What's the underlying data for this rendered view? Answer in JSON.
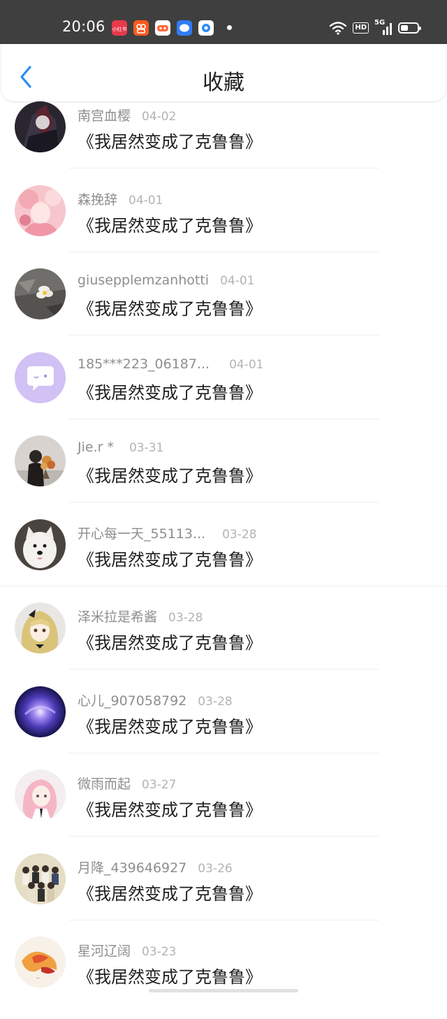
{
  "status_bar": {
    "time": "20:06",
    "hd_label": "HD",
    "network_label": "5G",
    "app_icons": [
      {
        "name": "xiaohongshu-app-icon",
        "color": "#e8394a"
      },
      {
        "name": "kuaishou-app-icon",
        "color": "#ff5a1f"
      },
      {
        "name": "game-center-app-icon",
        "color": "#ffffff"
      },
      {
        "name": "chat-app-icon",
        "color": "#2f7cf6"
      },
      {
        "name": "camera-app-icon",
        "color": "#2e8cf0"
      }
    ]
  },
  "header": {
    "title": "收藏",
    "back_icon": "chevron-left-icon",
    "accent_color": "#2a8cf2"
  },
  "list": [
    {
      "user": "南宫血樱",
      "date": "04-02",
      "book": "《我居然变成了克鲁鲁》",
      "avatar": "dark-anime-avatar"
    },
    {
      "user": "森挽辞",
      "date": "04-01",
      "book": "《我居然变成了克鲁鲁》",
      "avatar": "pink-anime-avatar"
    },
    {
      "user": "giusepplemzanhotti",
      "date": "04-01",
      "book": "《我居然变成了克鲁鲁》",
      "avatar": "flower-photo-avatar"
    },
    {
      "user": "185***223_06187...",
      "date": "04-01",
      "book": "《我居然变成了克鲁鲁》",
      "avatar": "default-chat-avatar"
    },
    {
      "user": "Jie.r *",
      "date": "03-31",
      "book": "《我居然变成了克鲁鲁》",
      "avatar": "bouquet-photo-avatar"
    },
    {
      "user": "开心每一天_55113...",
      "date": "03-28",
      "book": "《我居然变成了克鲁鲁》",
      "avatar": "white-dog-avatar"
    },
    {
      "user": "泽米拉是希酱",
      "date": "03-28",
      "book": "《我居然变成了克鲁鲁》",
      "avatar": "blonde-anime-avatar"
    },
    {
      "user": "心儿_907058792",
      "date": "03-28",
      "book": "《我居然变成了克鲁鲁》",
      "avatar": "galaxy-avatar"
    },
    {
      "user": "微雨而起",
      "date": "03-27",
      "book": "《我居然变成了克鲁鲁》",
      "avatar": "pink-hair-girl-avatar"
    },
    {
      "user": "月降_439646927",
      "date": "03-26",
      "book": "《我居然变成了克鲁鲁》",
      "avatar": "group-photo-avatar"
    },
    {
      "user": "星河辽阔",
      "date": "03-23",
      "book": "《我居然变成了克鲁鲁》",
      "avatar": "painting-avatar"
    }
  ]
}
